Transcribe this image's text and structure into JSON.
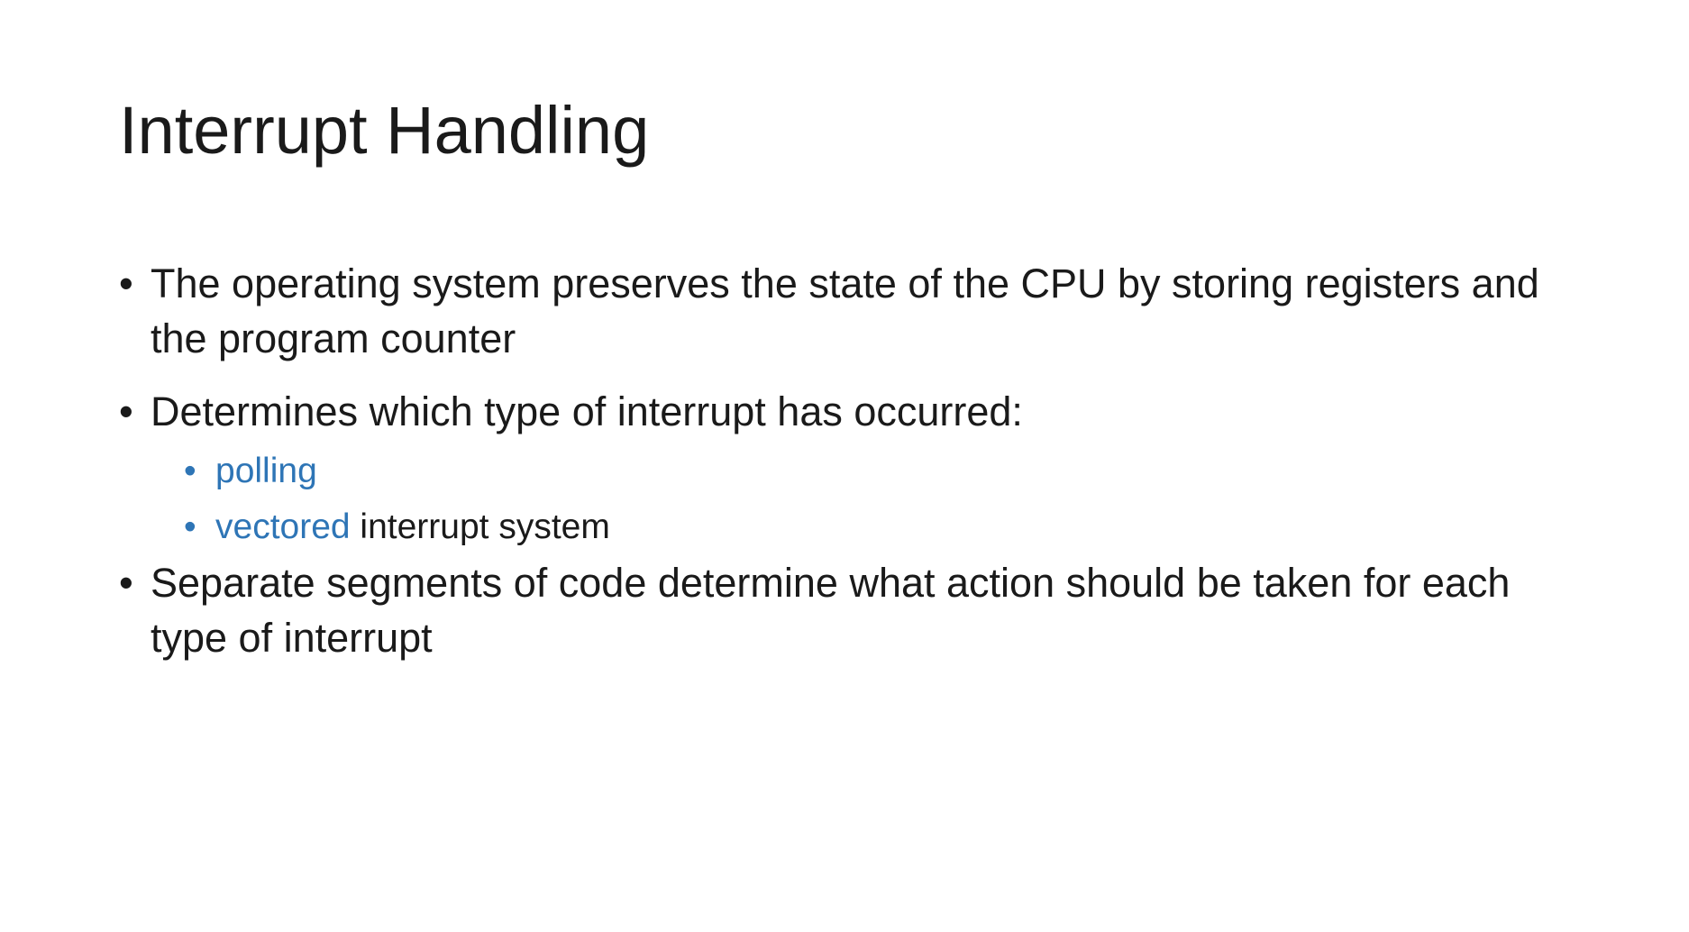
{
  "slide": {
    "title": "Interrupt Handling",
    "accent_color": "#2e75b6",
    "bullets": [
      {
        "text": "The operating system preserves the state of the CPU by storing registers and the program counter"
      },
      {
        "text": "Determines which type of interrupt has occurred:"
      },
      {
        "text": "Separate segments of code determine what action should be taken for each type of interrupt"
      }
    ],
    "sub_bullets": [
      {
        "highlight": "polling",
        "rest": ""
      },
      {
        "highlight": "vectored",
        "rest": " interrupt system"
      }
    ],
    "bullet_glyph": "•"
  }
}
